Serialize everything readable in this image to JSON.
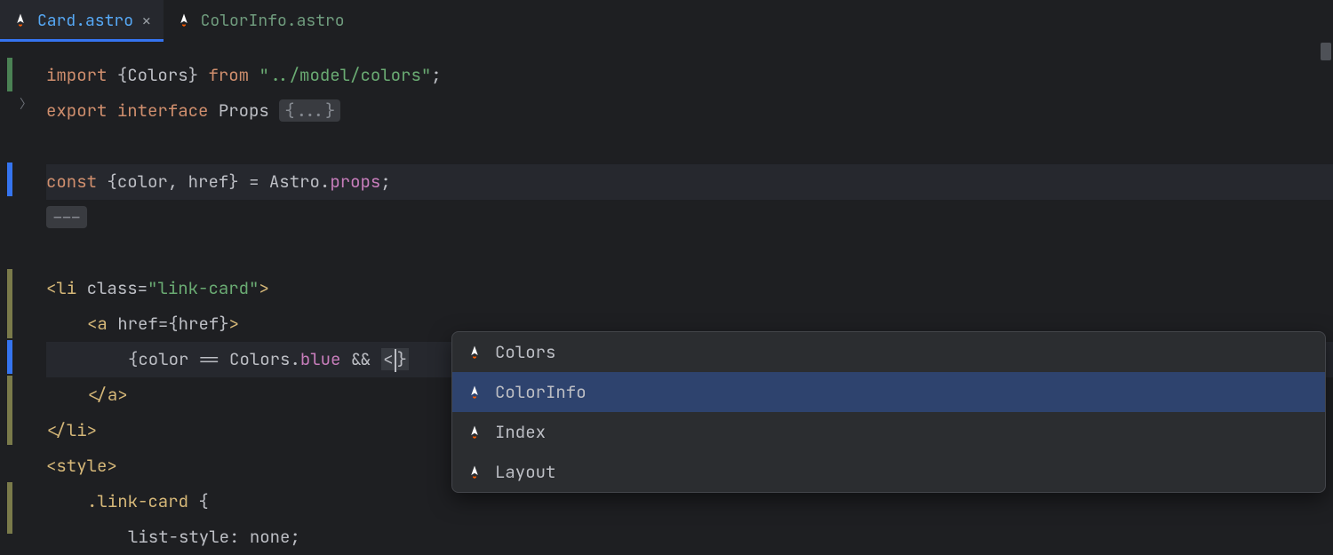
{
  "tabs": [
    {
      "label": "Card.astro",
      "active": true
    },
    {
      "label": "ColorInfo.astro",
      "active": false
    }
  ],
  "code": {
    "l1": {
      "kw1": "import",
      "brace1": "{",
      "id": "Colors",
      "brace2": "}",
      "kw2": "from",
      "str": "\"../model/colors\"",
      "semi": ";"
    },
    "l2": {
      "kw1": "export",
      "kw2": "interface",
      "id": "Props",
      "fold": "{...}"
    },
    "l4": {
      "kw": "const",
      "brace1": "{",
      "id1": "color",
      "comma": ",",
      "id2": "href",
      "brace2": "}",
      "eq": "=",
      "obj": "Astro",
      "dot": ".",
      "prop": "props",
      "semi": ";"
    },
    "l5": {
      "dashes": "---"
    },
    "l7": {
      "open": "<",
      "tag": "li",
      "attr": "class",
      "eq": "=",
      "val": "\"link-card\"",
      "close": ">"
    },
    "l8": {
      "open": "<",
      "tag": "a",
      "attr": "href",
      "eq": "=",
      "bro": "{",
      "id": "href",
      "brc": "}",
      "close": ">"
    },
    "l9": {
      "bro": "{",
      "id1": "color",
      "eq": "==",
      "obj": "Colors",
      "dot": ".",
      "prop": "blue",
      "and": "&&",
      "lt": "<",
      "brc": "}"
    },
    "l10": {
      "open": "</",
      "tag": "a",
      "close": ">"
    },
    "l11": {
      "open": "</",
      "tag": "li",
      "close": ">"
    },
    "l12": {
      "open": "<",
      "tag": "style",
      "close": ">"
    },
    "l13": {
      "sel": ".link-card",
      "brace": "{"
    },
    "l14": {
      "prop": "list-style",
      "colon": ":",
      "val": "none",
      "semi": ";"
    }
  },
  "autocomplete": {
    "items": [
      {
        "label": "Colors",
        "selected": false
      },
      {
        "label": "ColorInfo",
        "selected": true
      },
      {
        "label": "Index",
        "selected": false
      },
      {
        "label": "Layout",
        "selected": false
      }
    ]
  }
}
